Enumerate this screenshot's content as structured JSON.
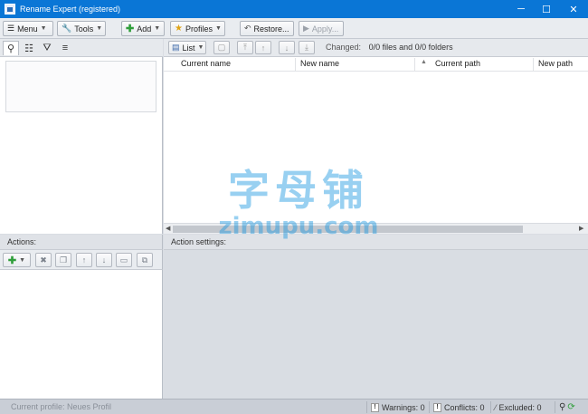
{
  "window": {
    "title": "Rename Expert (registered)",
    "minimize": "─",
    "maximize": "☐",
    "close": "✕"
  },
  "toolbar": {
    "menu": "Menu",
    "tools": "Tools",
    "add": "Add",
    "profiles": "Profiles",
    "restore": "Restore...",
    "apply": "Apply..."
  },
  "files": {
    "view_mode": "List",
    "changed_label": "Changed:",
    "changed_value": "0/0 files and 0/0 folders",
    "columns": [
      "Current name",
      "New name",
      "Current path",
      "New path"
    ]
  },
  "actions": {
    "header": "Actions:"
  },
  "settings": {
    "header": "Action settings:"
  },
  "status": {
    "profile": "Current profile: Neues Profil",
    "warnings": "Warnings: 0",
    "conflicts": "Conflicts: 0",
    "excluded": "Excluded: 0"
  },
  "watermark": {
    "chinese": "字母铺",
    "latin": "zimupu.com"
  },
  "colors": {
    "titlebar": "#0a76d6",
    "accent_green": "#2f9e3a",
    "watermark": "#1a96e1"
  }
}
